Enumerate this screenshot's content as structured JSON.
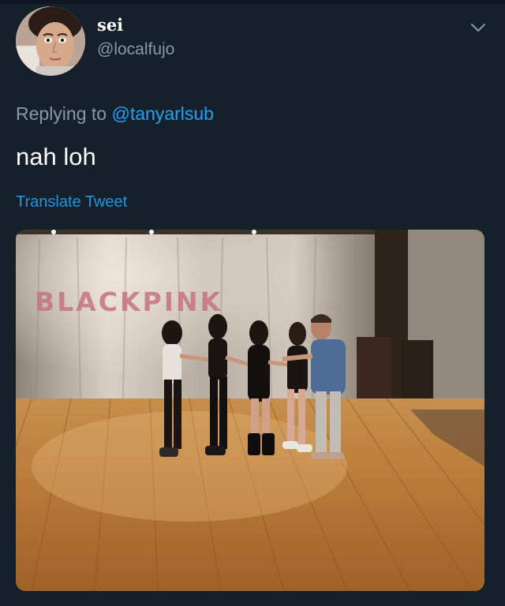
{
  "user": {
    "display_name": "sei",
    "handle": "@localfujo"
  },
  "reply": {
    "prefix": "Replying to",
    "mention": "@tanyarlsub"
  },
  "tweet": {
    "text": "nah loh",
    "translate_label": "Translate Tweet"
  },
  "media": {
    "backdrop_text": "BLACKPINK"
  },
  "icons": {
    "more": "chevron-down-icon"
  },
  "colors": {
    "background": "#15202b",
    "secondary_text": "#8899a6",
    "link": "#1da1f2"
  }
}
